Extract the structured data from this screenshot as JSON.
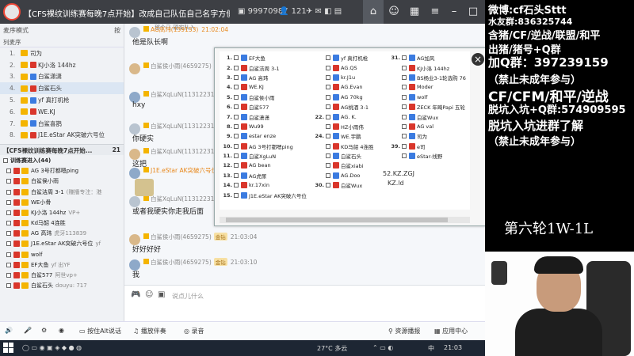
{
  "titlebar": {
    "title": "【CFS裸纹训练赛每晚7点开始】改成自己队伍自己名字方便...",
    "group_id": "99970987",
    "member_count": "121"
  },
  "left_panel": {
    "mode_label": "麦序模式",
    "sort_label": "按",
    "header2": "列麦序",
    "mic_list": [
      {
        "num": "1.",
        "name": "司为"
      },
      {
        "num": "2.",
        "name": "KJ小洛 144hz"
      },
      {
        "num": "3.",
        "name": "白鲨潇潇"
      },
      {
        "num": "4.",
        "name": "白鲨石头"
      },
      {
        "num": "5.",
        "name": "yf 真打机枪"
      },
      {
        "num": "6.",
        "name": "WE.KJ"
      },
      {
        "num": "7.",
        "name": "白鲨喜鹊"
      },
      {
        "num": "8.",
        "name": "J1E.eStar AK突破六号位"
      }
    ],
    "channel_title": "【CFS裸纹训练赛每晚7点开始...",
    "channel_count": "21",
    "sub_channel": "训练赛进入",
    "sub_count": "44",
    "members": [
      {
        "name": "AG 3号打都嗯ping",
        "extra": ""
      },
      {
        "name": "白鲨侯小雨",
        "extra": ""
      },
      {
        "name": "白鲨洁周 3-1",
        "extra": "(赚播专注：港"
      },
      {
        "name": "WE小骨",
        "extra": ""
      },
      {
        "name": "KJ小洛 144hz",
        "extra": "VP+"
      },
      {
        "name": "Kd马韶 4连胜",
        "extra": ""
      },
      {
        "name": "AG 高玮",
        "extra": "虎牙113839"
      },
      {
        "name": "J1E.eStar AK突破六号位",
        "extra": "yf"
      },
      {
        "name": "wolf",
        "extra": ""
      },
      {
        "name": "EF大鱼",
        "extra": "yf 出YF"
      },
      {
        "name": "白鲨577",
        "extra": "阿世vp+"
      },
      {
        "name": "白鲨石头",
        "extra": "douyu: 717"
      }
    ]
  },
  "chat": {
    "messages": [
      {
        "name": "AG高玮(159153)",
        "time": "21:02:04",
        "text": "他是队长啊"
      },
      {
        "name": "白鲨侯小雨(4659275)",
        "time": "",
        "text": ""
      },
      {
        "name": "白鲨XqLuN(1131223149)",
        "time": "21:02:",
        "text": "hxy"
      },
      {
        "name": "白鲨XqLuN(1131223149)",
        "time": "",
        "text": "你硬实"
      },
      {
        "name": "白鲨XqLuN(1131223149)",
        "time": "",
        "text": "这把"
      },
      {
        "name": "J1E.eStar AK突破六号位",
        "time": "",
        "text": ""
      },
      {
        "name": "白鲨XqLuN(1131223149)",
        "time": "",
        "text": "或者我硬实你走我后面"
      },
      {
        "name": "白鲨侯小雨(4659275)",
        "time": "21:03:04",
        "text": "好好好好"
      },
      {
        "name": "白鲨侯小雨(4659275)",
        "time": "21:03:10",
        "text": "我"
      }
    ],
    "top_text": "那个马 硬实队入",
    "gold_tag": "金钻",
    "input_placeholder": "说点儿什么"
  },
  "bottom_bar": {
    "push_to_talk": "按住Alt说话",
    "accompany": "播放伴奏",
    "record": "录音",
    "resources": "资源播报",
    "app_center": "应用中心"
  },
  "taskbar": {
    "temp": "27°C 多云",
    "ime": "中",
    "time": "21:03"
  },
  "overlay": {
    "col1": [
      "EF大鱼",
      "白鲨洁周 3-1",
      "AG 高玮",
      "WE.KJ",
      "白鲨侯小雨",
      "白鲨577",
      "白鲨潇潇",
      "Wu99",
      "estar enze",
      "AG 3号打都嗯ping",
      "白鲨XgLuN",
      "AG bean",
      "AG虎尿",
      "kr.17xin",
      "J1E.eStar AK突破六号位"
    ],
    "col2_nums": [
      "22.",
      "24.",
      "30."
    ],
    "col2": [
      "yf 真打机枪",
      "AG.QS",
      "kr.J1u",
      "AG.Evan",
      "AG 70kg",
      "AG桃酒 3-1",
      "AG. K.",
      "HZ小雨伟",
      "WE.宇鹏",
      "KD马韶 4连胜",
      "白鲨石头",
      "白鲨xiabi",
      "AG.Doo",
      "白鲨Wux"
    ],
    "col3_nums": [
      "31.",
      "",
      "",
      "",
      "",
      "",
      "",
      "39."
    ],
    "col3": [
      "AG加风",
      "KJ小洛 144hz",
      "BS杨业3-1轮选购 76",
      "Moder",
      "wolf",
      "ZECK 年畸Papi 五轮",
      "白鲨Wux",
      "AG val",
      "司为",
      "e司",
      "eStar-线野"
    ],
    "note1": "52.KZ.ZGJ",
    "note2": "KZ.ld"
  },
  "stream": {
    "lines": [
      "微博:cf石头Sttt",
      "水友群:836325744",
      "含猪/CF/逆战/联盟/和平",
      "出猪/猪号+Q群",
      "加Q群：397239159",
      "（禁止未成年参与）",
      "CF/CFM/和平/逆战",
      "脱坑入坑+Q群:574909595",
      "脱坑入坑进群了解",
      "（禁止未成年参与）"
    ],
    "round": "第六轮1W-1L"
  }
}
